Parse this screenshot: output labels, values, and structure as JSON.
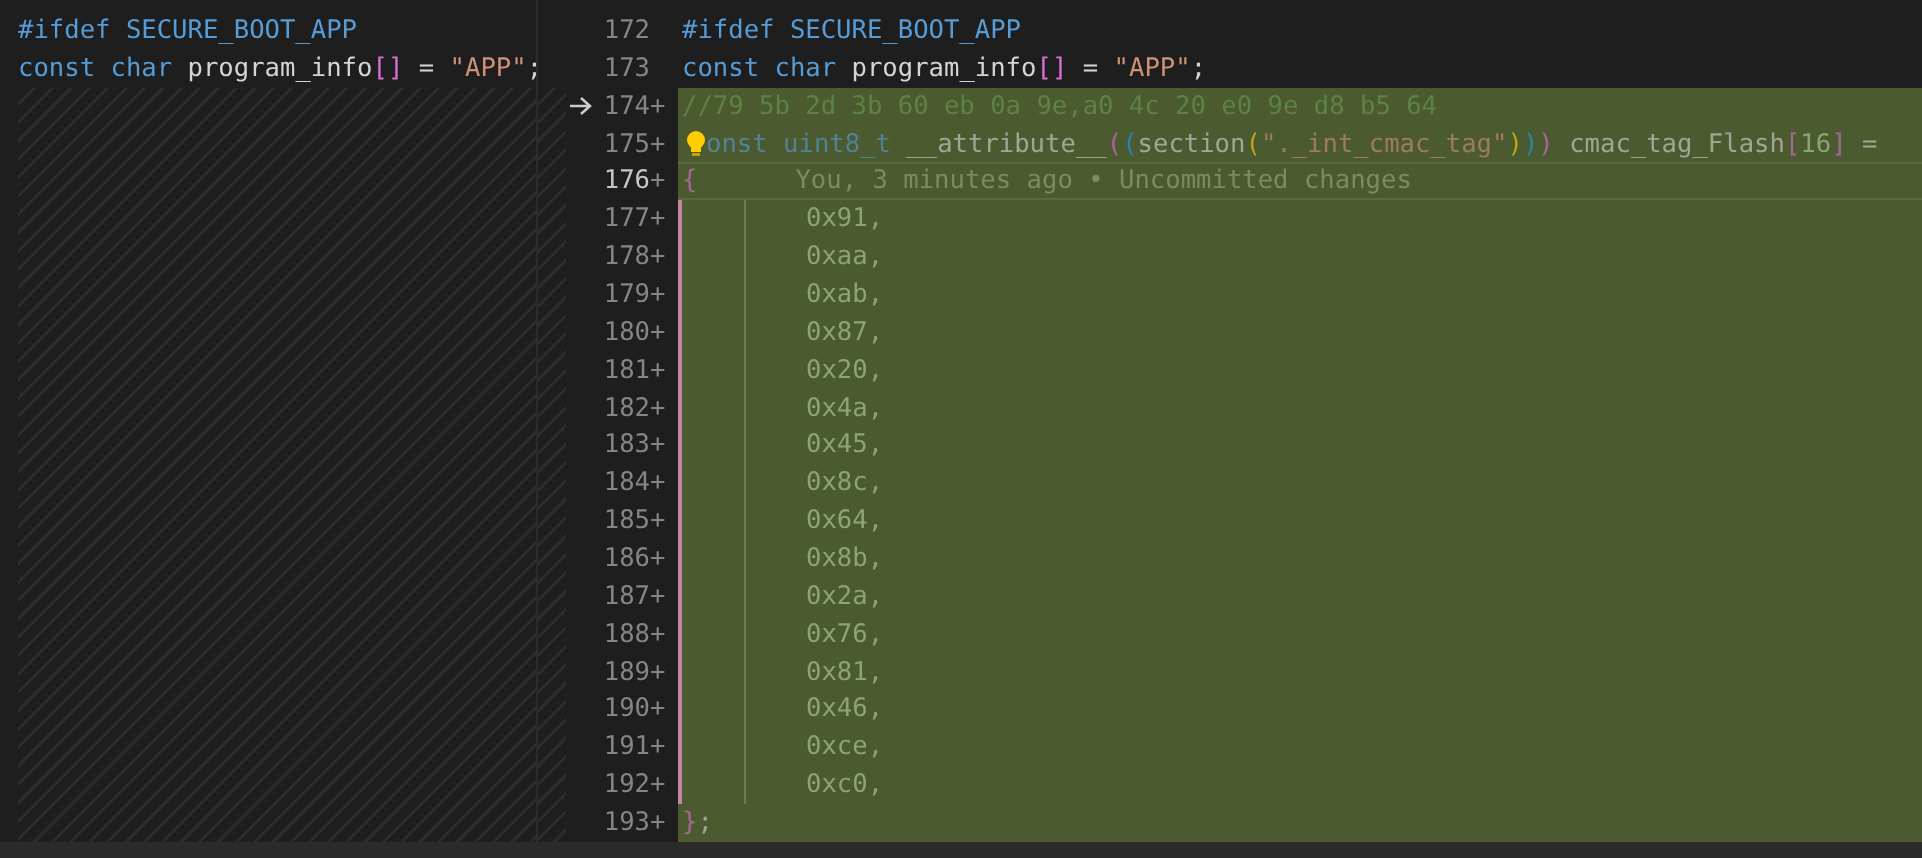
{
  "left_pane": {
    "lines": [
      {
        "tokens": [
          {
            "text": "#ifdef",
            "kind": "kw"
          },
          {
            "text": " SECURE_BOOT_APP",
            "kind": "macro"
          }
        ]
      },
      {
        "tokens": [
          {
            "text": "const",
            "kind": "kw"
          },
          {
            "text": " char",
            "kind": "kw"
          },
          {
            "text": " program_info",
            "kind": "id"
          },
          {
            "text": "[]",
            "kind": "br"
          },
          {
            "text": " = ",
            "kind": "id"
          },
          {
            "text": "\"APP\"",
            "kind": "str"
          },
          {
            "text": ";",
            "kind": "id"
          }
        ]
      }
    ]
  },
  "right_pane": {
    "lines": [
      {
        "number": "172",
        "added": false,
        "tokens": [
          {
            "text": "#ifdef",
            "kind": "kw"
          },
          {
            "text": " SECURE_BOOT_APP",
            "kind": "macro"
          }
        ]
      },
      {
        "number": "173",
        "added": false,
        "tokens": [
          {
            "text": "const",
            "kind": "kw"
          },
          {
            "text": " char",
            "kind": "kw"
          },
          {
            "text": " program_info",
            "kind": "id"
          },
          {
            "text": "[]",
            "kind": "br"
          },
          {
            "text": " = ",
            "kind": "id"
          },
          {
            "text": "\"APP\"",
            "kind": "str"
          },
          {
            "text": ";",
            "kind": "id"
          }
        ]
      },
      {
        "number": "174",
        "sign": "+",
        "added": true,
        "pointer": true,
        "tokens": [
          {
            "text": "//79 5b 2d 3b 60 eb 0a 9e,a0 4c 20 e0 9e d8 b5 64",
            "kind": "com"
          }
        ]
      },
      {
        "number": "175",
        "sign": "+",
        "added": true,
        "lightbulb": true,
        "tokens": [
          {
            "text": "onst",
            "kind": "kw"
          },
          {
            "text": " uint8_t",
            "kind": "kw"
          },
          {
            "text": " __attribute__",
            "kind": "id"
          },
          {
            "text": "(",
            "kind": "br"
          },
          {
            "text": "(",
            "kind": "br2"
          },
          {
            "text": "section",
            "kind": "id"
          },
          {
            "text": "(",
            "kind": "br3"
          },
          {
            "text": "\"._int_cmac_tag\"",
            "kind": "str"
          },
          {
            "text": ")",
            "kind": "br3"
          },
          {
            "text": ")",
            "kind": "br2"
          },
          {
            "text": ")",
            "kind": "br"
          },
          {
            "text": " cmac_tag_Flash",
            "kind": "id"
          },
          {
            "text": "[",
            "kind": "br"
          },
          {
            "text": "16",
            "kind": "num"
          },
          {
            "text": "]",
            "kind": "br"
          },
          {
            "text": " =",
            "kind": "id"
          }
        ]
      },
      {
        "number": "176",
        "sign": "+",
        "added": true,
        "current": true,
        "blame": "You, 3 minutes ago • Uncommitted changes",
        "tokens": [
          {
            "text": "{",
            "kind": "br"
          }
        ]
      },
      {
        "number": "177",
        "sign": "+",
        "added": true,
        "indented": true,
        "tokens": [
          {
            "text": "0x91,",
            "kind": "num"
          }
        ]
      },
      {
        "number": "178",
        "sign": "+",
        "added": true,
        "indented": true,
        "tokens": [
          {
            "text": "0xaa,",
            "kind": "num"
          }
        ]
      },
      {
        "number": "179",
        "sign": "+",
        "added": true,
        "indented": true,
        "tokens": [
          {
            "text": "0xab,",
            "kind": "num"
          }
        ]
      },
      {
        "number": "180",
        "sign": "+",
        "added": true,
        "indented": true,
        "tokens": [
          {
            "text": "0x87,",
            "kind": "num"
          }
        ]
      },
      {
        "number": "181",
        "sign": "+",
        "added": true,
        "indented": true,
        "tokens": [
          {
            "text": "0x20,",
            "kind": "num"
          }
        ]
      },
      {
        "number": "182",
        "sign": "+",
        "added": true,
        "indented": true,
        "tokens": [
          {
            "text": "0x4a,",
            "kind": "num"
          }
        ]
      },
      {
        "number": "183",
        "sign": "+",
        "added": true,
        "indented": true,
        "tokens": [
          {
            "text": "0x45,",
            "kind": "num"
          }
        ]
      },
      {
        "number": "184",
        "sign": "+",
        "added": true,
        "indented": true,
        "tokens": [
          {
            "text": "0x8c,",
            "kind": "num"
          }
        ]
      },
      {
        "number": "185",
        "sign": "+",
        "added": true,
        "indented": true,
        "tokens": [
          {
            "text": "0x64,",
            "kind": "num"
          }
        ]
      },
      {
        "number": "186",
        "sign": "+",
        "added": true,
        "indented": true,
        "tokens": [
          {
            "text": "0x8b,",
            "kind": "num"
          }
        ]
      },
      {
        "number": "187",
        "sign": "+",
        "added": true,
        "indented": true,
        "tokens": [
          {
            "text": "0x2a,",
            "kind": "num"
          }
        ]
      },
      {
        "number": "188",
        "sign": "+",
        "added": true,
        "indented": true,
        "tokens": [
          {
            "text": "0x76,",
            "kind": "num"
          }
        ]
      },
      {
        "number": "189",
        "sign": "+",
        "added": true,
        "indented": true,
        "tokens": [
          {
            "text": "0x81,",
            "kind": "num"
          }
        ]
      },
      {
        "number": "190",
        "sign": "+",
        "added": true,
        "indented": true,
        "tokens": [
          {
            "text": "0x46,",
            "kind": "num"
          }
        ]
      },
      {
        "number": "191",
        "sign": "+",
        "added": true,
        "indented": true,
        "tokens": [
          {
            "text": "0xce,",
            "kind": "num"
          }
        ]
      },
      {
        "number": "192",
        "sign": "+",
        "added": true,
        "indented": true,
        "tokens": [
          {
            "text": "0xc0,",
            "kind": "num"
          }
        ]
      },
      {
        "number": "193",
        "sign": "+",
        "added": true,
        "tokens": [
          {
            "text": "}",
            "kind": "br"
          },
          {
            "text": ";",
            "kind": "id"
          }
        ]
      }
    ]
  }
}
